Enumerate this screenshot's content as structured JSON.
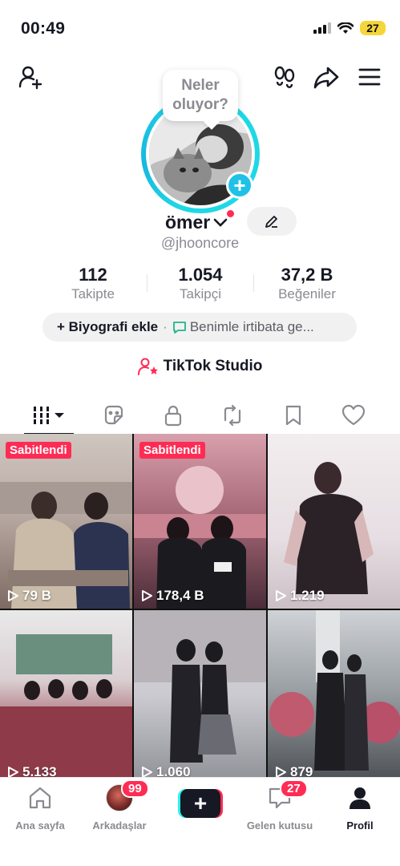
{
  "status_bar": {
    "time": "00:49",
    "battery": "27"
  },
  "top_bar": {
    "icons": [
      "add-friend-icon",
      "footprints-icon",
      "share-icon",
      "menu-icon"
    ]
  },
  "profile": {
    "bubble_text": "Neler oluyor?",
    "display_name": "ömer",
    "username": "@jhooncore"
  },
  "stats": [
    {
      "value": "112",
      "label": "Takipte"
    },
    {
      "value": "1.054",
      "label": "Takipçi"
    },
    {
      "value": "37,2 B",
      "label": "Beğeniler"
    }
  ],
  "bio": {
    "add_label": "+ Biyografi ekle",
    "separator": "·",
    "contact_label": "Benimle irtibata ge..."
  },
  "studio_label": "TikTok Studio",
  "tabs": [
    "grid-icon",
    "repost-sticker-icon",
    "lock-icon",
    "repost-icon",
    "bookmark-icon",
    "heart-icon"
  ],
  "videos": [
    {
      "pinned": "Sabitlendi",
      "views": "79 B"
    },
    {
      "pinned": "Sabitlendi",
      "views": "178,4 B"
    },
    {
      "pinned": "",
      "views": "1.219"
    },
    {
      "pinned": "",
      "views": "5.133"
    },
    {
      "pinned": "",
      "views": "1.060"
    },
    {
      "pinned": "",
      "views": "879"
    }
  ],
  "bottom_nav": {
    "home": "Ana sayfa",
    "friends": "Arkadaşlar",
    "friends_badge": "99",
    "inbox": "Gelen kutusu",
    "inbox_badge": "27",
    "profile": "Profil"
  },
  "colors": {
    "accent": "#fe2c55",
    "cyan": "#25f4ee",
    "ring": "#1fd8e6"
  }
}
